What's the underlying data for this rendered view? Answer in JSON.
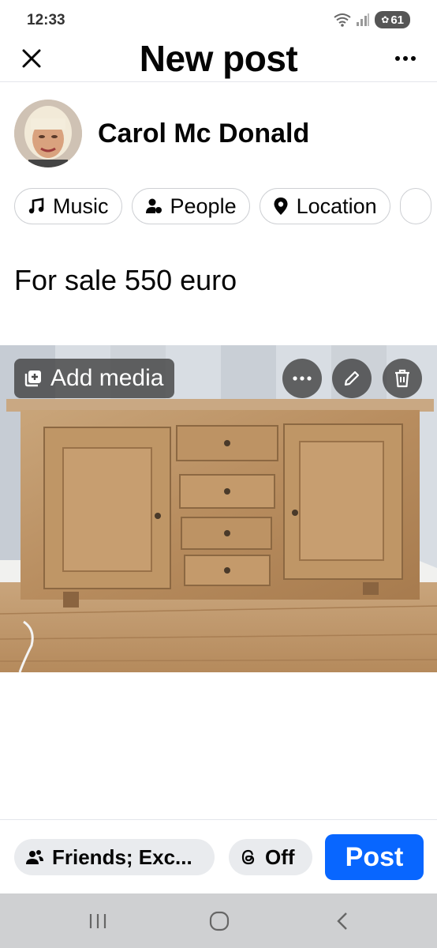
{
  "status_bar": {
    "time": "12:33",
    "battery": "61"
  },
  "header": {
    "title": "New post"
  },
  "user": {
    "name": "Carol Mc Donald"
  },
  "chips": [
    {
      "label": "Music",
      "icon": "music-note-icon"
    },
    {
      "label": "People",
      "icon": "people-icon"
    },
    {
      "label": "Location",
      "icon": "location-pin-icon"
    }
  ],
  "post": {
    "text": "For sale 550 euro"
  },
  "media": {
    "add_label": "Add media",
    "more_icon": "more-horizontal-icon",
    "edit_icon": "pencil-icon",
    "delete_icon": "trash-icon"
  },
  "bottom_bar": {
    "audience_label": "Friends; Exc...",
    "threads_label": "Off",
    "post_label": "Post"
  },
  "colors": {
    "accent": "#0866ff",
    "chip_border": "#ced0d4",
    "pill_bg": "#e9ebee",
    "nav_bar": "#cfd0d2"
  }
}
